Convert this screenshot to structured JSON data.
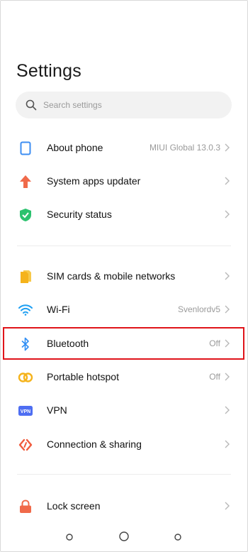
{
  "header": {
    "title": "Settings"
  },
  "search": {
    "placeholder": "Search settings",
    "icon": "search-icon"
  },
  "sections": [
    {
      "items": [
        {
          "label": "About phone",
          "value": "MIUI Global 13.0.3",
          "icon": "phone-icon",
          "color": "#3d8ef2"
        },
        {
          "label": "System apps updater",
          "value": "",
          "icon": "arrow-up-icon",
          "color": "#f06a4a"
        },
        {
          "label": "Security status",
          "value": "",
          "icon": "shield-check-icon",
          "color": "#2bc26e"
        }
      ]
    },
    {
      "items": [
        {
          "label": "SIM cards & mobile networks",
          "value": "",
          "icon": "sim-card-icon",
          "color": "#f5b31b"
        },
        {
          "label": "Wi-Fi",
          "value": "Svenlordv5",
          "icon": "wifi-icon",
          "color": "#1e9ff2"
        },
        {
          "label": "Bluetooth",
          "value": "Off",
          "icon": "bluetooth-icon",
          "color": "#2f8ef4",
          "highlighted": true
        },
        {
          "label": "Portable hotspot",
          "value": "Off",
          "icon": "hotspot-icon",
          "color": "#f5b31b"
        },
        {
          "label": "VPN",
          "value": "",
          "icon": "vpn-icon",
          "color": "#4e6ef2",
          "badge": "VPN"
        },
        {
          "label": "Connection & sharing",
          "value": "",
          "icon": "connection-sharing-icon",
          "color": "#f05a3c"
        }
      ]
    },
    {
      "items": [
        {
          "label": "Lock screen",
          "value": "",
          "icon": "lock-icon",
          "color": "#f06a4a"
        }
      ]
    }
  ],
  "colors": {
    "highlight": "#e0141a",
    "chevron": "#b8b8b8",
    "secondary_text": "#9a9a9a"
  },
  "navbar": {
    "icons": [
      "recent-apps-icon",
      "home-icon",
      "back-icon"
    ]
  }
}
